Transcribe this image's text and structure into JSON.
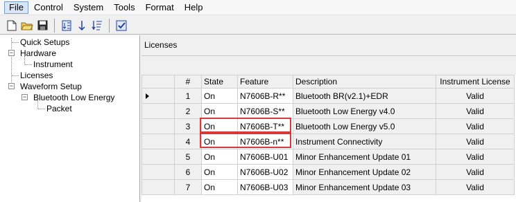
{
  "menu": [
    "File",
    "Control",
    "System",
    "Tools",
    "Format",
    "Help"
  ],
  "toolbar": {
    "icons": [
      "new-file-icon",
      "open-folder-icon",
      "save-icon",
      "sort-icon",
      "download-icon",
      "list-sort-icon",
      "checklist-icon"
    ]
  },
  "tree": {
    "quick_setups": "Quick Setups",
    "hardware": "Hardware",
    "instrument": "Instrument",
    "licenses": "Licenses",
    "waveform_setup": "Waveform Setup",
    "bluetooth_le": "Bluetooth Low Energy",
    "packet": "Packet",
    "expanded_symbol": "−"
  },
  "panel": {
    "title": "Licenses"
  },
  "table": {
    "headers": [
      "#",
      "State",
      "Feature",
      "Description",
      "Instrument License"
    ],
    "rows": [
      {
        "num": "1",
        "state": "On",
        "feature": "N7606B-R**",
        "description": "Bluetooth BR(v2.1)+EDR",
        "license": "Valid"
      },
      {
        "num": "2",
        "state": "On",
        "feature": "N7606B-S**",
        "description": "Bluetooth Low Energy v4.0",
        "license": "Valid"
      },
      {
        "num": "3",
        "state": "On",
        "feature": "N7606B-T**",
        "description": "Bluetooth Low Energy v5.0",
        "license": "Valid"
      },
      {
        "num": "4",
        "state": "On",
        "feature": "N7606B-n**",
        "description": "Instrument Connectivity",
        "license": "Valid"
      },
      {
        "num": "5",
        "state": "On",
        "feature": "N7606B-U01",
        "description": "Minor Enhancement Update 01",
        "license": "Valid"
      },
      {
        "num": "6",
        "state": "On",
        "feature": "N7606B-U02",
        "description": "Minor Enhancement Update 02",
        "license": "Valid"
      },
      {
        "num": "7",
        "state": "On",
        "feature": "N7606B-U03",
        "description": "Minor Enhancement Update 03",
        "license": "Valid"
      }
    ],
    "current_row": 1,
    "highlighted_rows": [
      3,
      4
    ],
    "highlight_color": "#d9373a"
  }
}
